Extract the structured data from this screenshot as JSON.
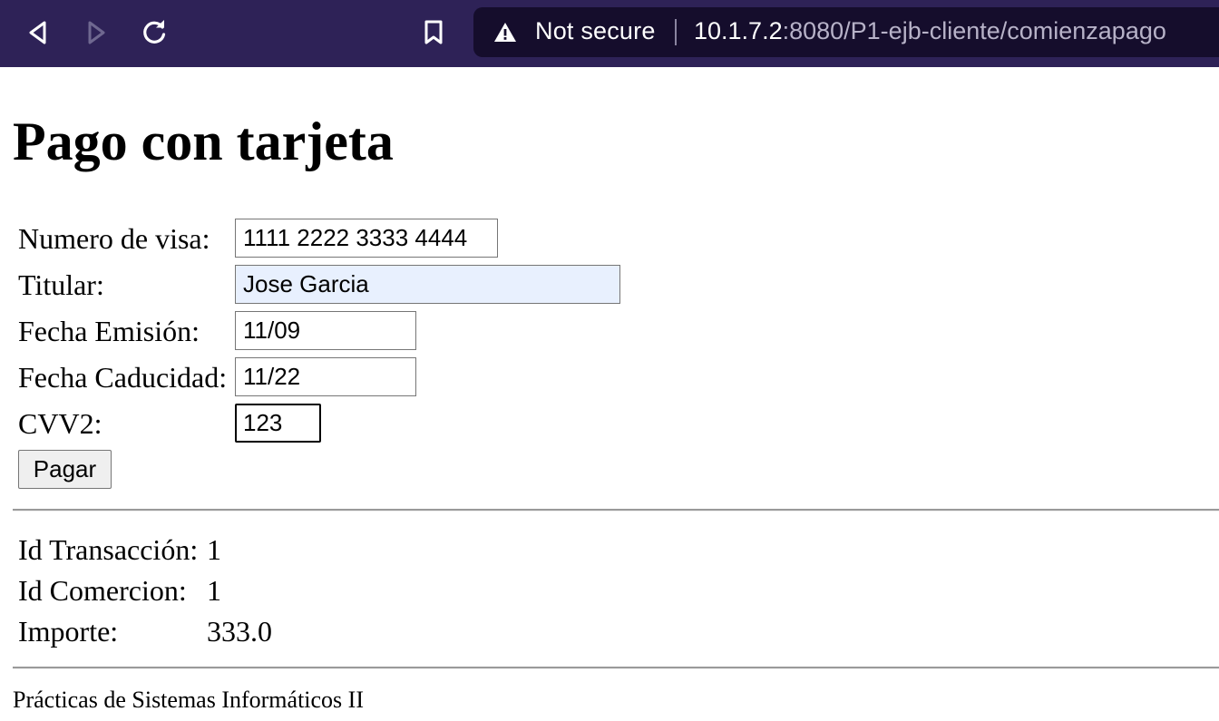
{
  "browser": {
    "security_label": "Not secure",
    "url_host": "10.1.7.2",
    "url_rest": ":8080/P1-ejb-cliente/comienzapago",
    "icons": {
      "back": "back-arrow-icon",
      "forward": "forward-arrow-icon",
      "reload": "reload-icon",
      "bookmark": "bookmark-icon",
      "warning": "warning-triangle-icon"
    },
    "colors": {
      "toolbar": "#2e2257",
      "urlbar": "#150d2c",
      "url_path": "#b7b2c8"
    }
  },
  "page": {
    "title": "Pago con tarjeta",
    "form": {
      "visa_label": "Numero de visa:",
      "visa_value": "1111 2222 3333 4444",
      "holder_label": "Titular:",
      "holder_value": "Jose Garcia",
      "issue_label": "Fecha Emisión:",
      "issue_value": "11/09",
      "expiry_label": "Fecha Caducidad:",
      "expiry_value": "11/22",
      "cvv_label": "CVV2:",
      "cvv_value": "123",
      "submit_label": "Pagar"
    },
    "info": {
      "transaction_label": "Id Transacción:",
      "transaction_value": "1",
      "commerce_label": "Id Comercion:",
      "commerce_value": "1",
      "amount_label": "Importe:",
      "amount_value": "333.0"
    },
    "footer": "Prácticas de Sistemas Informáticos II"
  }
}
